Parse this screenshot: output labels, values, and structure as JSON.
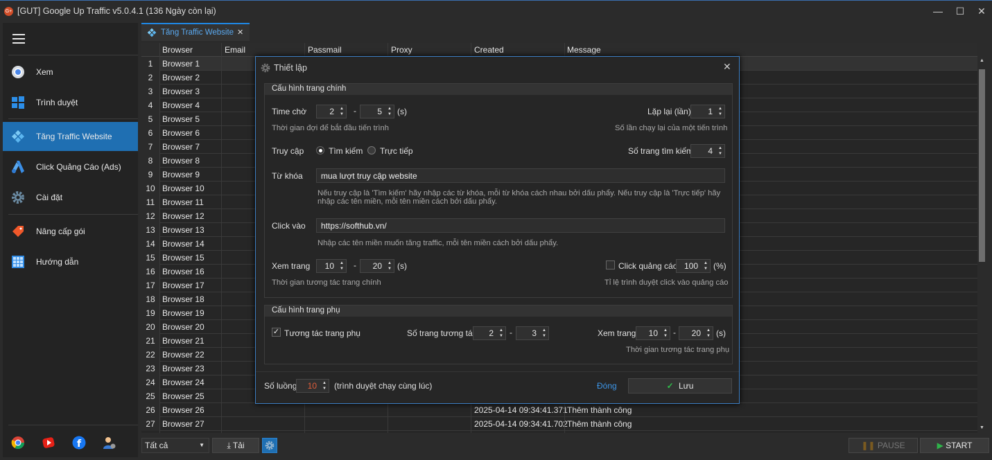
{
  "window": {
    "title": "[GUT] Google Up Traffic v5.0.4.1 (136 Ngày còn lại)",
    "icon_text": "G+",
    "minimize": "—",
    "maximize": "☐",
    "close": "✕"
  },
  "sidebar": {
    "items": [
      {
        "label": "Xem",
        "icon": "chrome-icon"
      },
      {
        "label": "Trình duyệt",
        "icon": "windows-icon"
      },
      {
        "label": "Tăng Traffic Website",
        "icon": "kodi-icon"
      },
      {
        "label": "Click Quảng Cáo (Ads)",
        "icon": "ads-icon"
      },
      {
        "label": "Cài đặt",
        "icon": "gear-icon"
      },
      {
        "label": "Nâng cấp gói",
        "icon": "tag-icon"
      },
      {
        "label": "Hướng dẫn",
        "icon": "grid-icon"
      }
    ],
    "bottom_icons": [
      "chrome-icon",
      "youtube-icon",
      "facebook-icon",
      "support-icon"
    ]
  },
  "tab": {
    "label": "Tăng Traffic Website",
    "close": "✕"
  },
  "grid": {
    "headers": [
      "Browser",
      "Email",
      "Passmail",
      "Proxy",
      "Created",
      "Message"
    ],
    "rows": [
      {
        "n": "1",
        "browser": "Browser 1",
        "created": "",
        "message": ""
      },
      {
        "n": "2",
        "browser": "Browser 2",
        "created": "",
        "message": ""
      },
      {
        "n": "3",
        "browser": "Browser 3",
        "created": "",
        "message": ""
      },
      {
        "n": "4",
        "browser": "Browser 4",
        "created": "",
        "message": ""
      },
      {
        "n": "5",
        "browser": "Browser 5",
        "created": "",
        "message": ""
      },
      {
        "n": "6",
        "browser": "Browser 6",
        "created": "",
        "message": ""
      },
      {
        "n": "7",
        "browser": "Browser 7",
        "created": "",
        "message": ""
      },
      {
        "n": "8",
        "browser": "Browser 8",
        "created": "",
        "message": ""
      },
      {
        "n": "9",
        "browser": "Browser 9",
        "created": "",
        "message": ""
      },
      {
        "n": "10",
        "browser": "Browser 10",
        "created": "",
        "message": ""
      },
      {
        "n": "11",
        "browser": "Browser 11",
        "created": "",
        "message": ""
      },
      {
        "n": "12",
        "browser": "Browser 12",
        "created": "",
        "message": ""
      },
      {
        "n": "13",
        "browser": "Browser 13",
        "created": "",
        "message": ""
      },
      {
        "n": "14",
        "browser": "Browser 14",
        "created": "",
        "message": ""
      },
      {
        "n": "15",
        "browser": "Browser 15",
        "created": "",
        "message": ""
      },
      {
        "n": "16",
        "browser": "Browser 16",
        "created": "",
        "message": ""
      },
      {
        "n": "17",
        "browser": "Browser 17",
        "created": "",
        "message": ""
      },
      {
        "n": "18",
        "browser": "Browser 18",
        "created": "",
        "message": ""
      },
      {
        "n": "19",
        "browser": "Browser 19",
        "created": "",
        "message": ""
      },
      {
        "n": "20",
        "browser": "Browser 20",
        "created": "",
        "message": ""
      },
      {
        "n": "21",
        "browser": "Browser 21",
        "created": "",
        "message": ""
      },
      {
        "n": "22",
        "browser": "Browser 22",
        "created": "",
        "message": ""
      },
      {
        "n": "23",
        "browser": "Browser 23",
        "created": "",
        "message": ""
      },
      {
        "n": "24",
        "browser": "Browser 24",
        "created": "",
        "message": ""
      },
      {
        "n": "25",
        "browser": "Browser 25",
        "created": "",
        "message": ""
      },
      {
        "n": "26",
        "browser": "Browser 26",
        "created": "2025-04-14 09:34:41.371",
        "message": "Thêm thành công"
      },
      {
        "n": "27",
        "browser": "Browser 27",
        "created": "2025-04-14 09:34:41.702",
        "message": "Thêm thành công"
      }
    ]
  },
  "bottom": {
    "filter": "Tất cả",
    "load": "Tải",
    "pause": "PAUSE",
    "start": "START"
  },
  "dialog": {
    "title": "Thiết lập",
    "close": "✕",
    "main_section": "Cấu hình trang chính",
    "wait_label": "Time chờ",
    "wait_min": "2",
    "wait_max": "5",
    "wait_unit": "(s)",
    "wait_hint": "Thời gian đợi để bắt đầu tiến trình",
    "repeat_label": "Lặp lại (lần)",
    "repeat_value": "1",
    "repeat_hint": "Số lần chạy lại của một tiến trình",
    "access_label": "Truy cập",
    "access_search": "Tìm kiếm",
    "access_direct": "Trực tiếp",
    "search_pages_label": "Số trang tìm kiếm",
    "search_pages_value": "4",
    "keyword_label": "Từ khóa",
    "keyword_value": "mua lượt truy cập website",
    "keyword_hint_1": "Nếu truy cập là 'Tìm kiếm' hãy nhập các từ khóa, mỗi từ khóa cách nhau bởi dấu phẩy. Nếu truy cập là 'Trực tiếp' hãy",
    "keyword_hint_2": "nhập các tên miền, mỗi tên miền cách bởi dấu phẩy.",
    "click_label": "Click vào",
    "click_value": "https://softhub.vn/",
    "click_hint": "Nhập các tên miền muốn tăng traffic, mỗi tên miền cách bởi dấu phẩy.",
    "view_label": "Xem trang",
    "view_min": "10",
    "view_max": "20",
    "view_unit": "(s)",
    "view_hint": "Thời gian tương tác trang chính",
    "ads_label": "Click quảng cáo",
    "ads_value": "100",
    "ads_unit": "(%)",
    "ads_hint": "Tỉ lệ trình duyệt click vào quảng cáo",
    "sub_section": "Cấu hình trang phụ",
    "sub_interact": "Tương tác trang phụ",
    "sub_pages_label": "Số trang tương tác",
    "sub_pages_min": "2",
    "sub_pages_max": "3",
    "sub_view_label": "Xem trang",
    "sub_view_min": "10",
    "sub_view_max": "20",
    "sub_view_unit": "(s)",
    "sub_view_hint": "Thời gian tương tác trang phụ",
    "threads_label": "Số luồng",
    "threads_value": "10",
    "threads_hint": "(trình duyệt chạy cùng lúc)",
    "close_btn": "Đóng",
    "save_btn": "Lưu",
    "dash": "-",
    "check_mark": "✓"
  }
}
